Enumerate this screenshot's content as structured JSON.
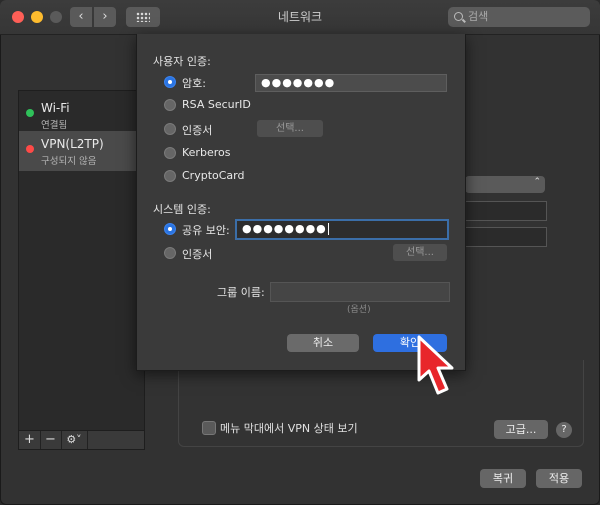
{
  "window": {
    "title": "네트워크"
  },
  "search": {
    "placeholder": "검색"
  },
  "sidebar": {
    "services": [
      {
        "name": "Wi-Fi",
        "status": "연결됨",
        "status_color": "#2fc15a"
      },
      {
        "name": "VPN(L2TP)",
        "status": "구성되지 않음",
        "status_color": "#ff4a47"
      }
    ],
    "tools": {
      "add": "+",
      "remove": "−",
      "gear": "⚙︎˅"
    }
  },
  "sheet": {
    "user_auth": {
      "label": "사용자 인증:",
      "options": [
        {
          "label": "암호:",
          "selected": true
        },
        {
          "label": "RSA SecurID",
          "selected": false
        },
        {
          "label": "인증서",
          "selected": false
        },
        {
          "label": "Kerberos",
          "selected": false
        },
        {
          "label": "CryptoCard",
          "selected": false
        }
      ],
      "password_value": "●●●●●●●",
      "select_button": "선택..."
    },
    "system_auth": {
      "label": "시스템 인증:",
      "options": [
        {
          "label": "공유 보안:",
          "selected": true
        },
        {
          "label": "인증서",
          "selected": false
        }
      ],
      "shared_secret_value": "●●●●●●●●",
      "select_button": "선택..."
    },
    "group_name": {
      "label": "그룹 이름:",
      "value": "",
      "hint": "(옵션)"
    },
    "cancel": "취소",
    "ok": "확인"
  },
  "main": {
    "menu_checkbox_label": "메뉴 막대에서 VPN 상태 보기",
    "menu_checkbox_checked": false,
    "advanced": "고급...",
    "help": "?",
    "revert": "복귀",
    "apply": "적용"
  },
  "colors": {
    "accent": "#2e6fe0",
    "cursor": "#e8262b"
  }
}
